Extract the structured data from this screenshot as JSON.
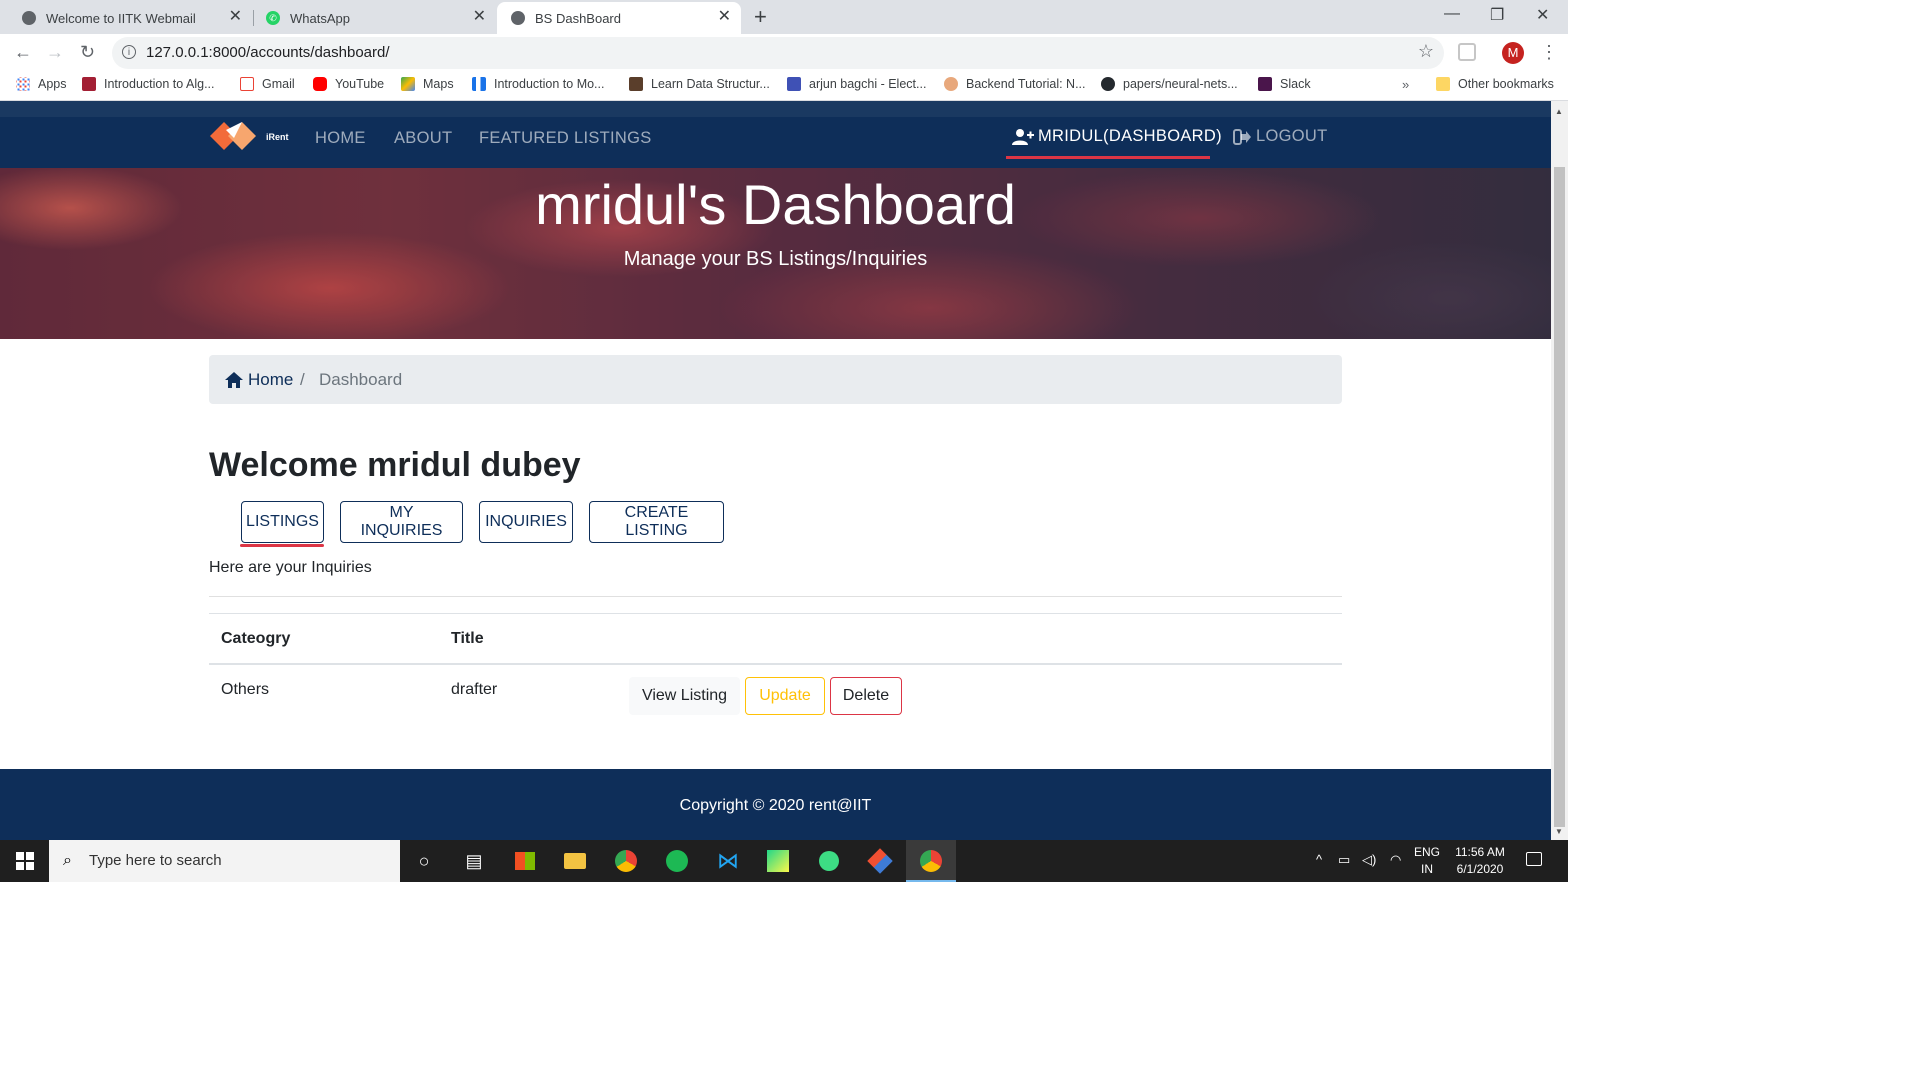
{
  "browser": {
    "tabs": [
      {
        "title": "Welcome to IITK Webmail"
      },
      {
        "title": "WhatsApp"
      },
      {
        "title": "BS DashBoard"
      }
    ],
    "url": "127.0.0.1:8000/accounts/dashboard/",
    "profile_initial": "M",
    "bookmarks": [
      {
        "label": "Apps"
      },
      {
        "label": "Introduction to Alg..."
      },
      {
        "label": "Gmail"
      },
      {
        "label": "YouTube"
      },
      {
        "label": "Maps"
      },
      {
        "label": "Introduction to Mo..."
      },
      {
        "label": "Learn Data Structur..."
      },
      {
        "label": "arjun bagchi - Elect..."
      },
      {
        "label": "Backend Tutorial: N..."
      },
      {
        "label": "papers/neural-nets..."
      },
      {
        "label": "Slack"
      }
    ],
    "bookmarks_more": "»",
    "other_bookmarks": "Other bookmarks"
  },
  "site": {
    "logo_text": "iRent",
    "nav": {
      "home": "HOME",
      "about": "ABOUT",
      "featured": "FEATURED LISTINGS",
      "dashboard": "MRIDUL(DASHBOARD)",
      "logout": "LOGOUT"
    },
    "hero": {
      "title": "mridul's Dashboard",
      "subtitle": "Manage your BS Listings/Inquiries"
    },
    "breadcrumb": {
      "home": "Home",
      "separator": "/",
      "current": "Dashboard"
    },
    "welcome": "Welcome mridul dubey",
    "tabs": {
      "listings": "LISTINGS",
      "my_inquiries": "MY INQUIRIES",
      "inquiries": "INQUIRIES",
      "create": "CREATE LISTING"
    },
    "intro": "Here are your Inquiries",
    "table": {
      "headers": {
        "category": "Cateogry",
        "title": "Title"
      },
      "rows": [
        {
          "category": "Others",
          "title": "drafter",
          "view": "View Listing",
          "update": "Update",
          "delete": "Delete"
        }
      ]
    },
    "footer": "Copyright © 2020 rent@IIT",
    "colors": {
      "navy": "#0e2e59",
      "accent_red": "#dc3545",
      "warning": "#ffc107"
    }
  },
  "taskbar": {
    "search_placeholder": "Type here to search",
    "lang_top": "ENG",
    "lang_bottom": "IN",
    "time": "11:56 AM",
    "date": "6/1/2020"
  }
}
